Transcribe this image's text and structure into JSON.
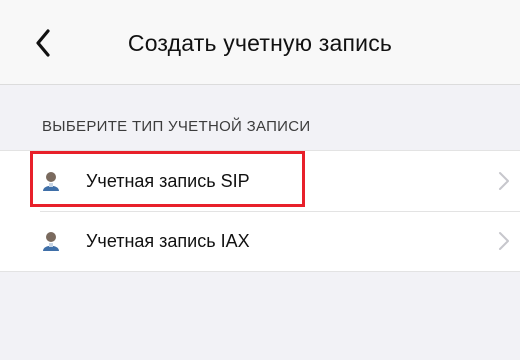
{
  "navbar": {
    "title": "Создать учетную запись",
    "back_icon": "chevron-left-icon"
  },
  "section": {
    "header": "ВЫБЕРИТЕ ТИП УЧЕТНОЙ ЗАПИСИ"
  },
  "accounts": [
    {
      "label": "Учетная запись SIP",
      "icon": "user-avatar-icon",
      "selected": true
    },
    {
      "label": "Учетная запись IAX",
      "icon": "user-avatar-icon",
      "selected": false
    }
  ],
  "colors": {
    "highlight": "#e8202a",
    "background": "#f2f2f6",
    "row_background": "#ffffff"
  }
}
